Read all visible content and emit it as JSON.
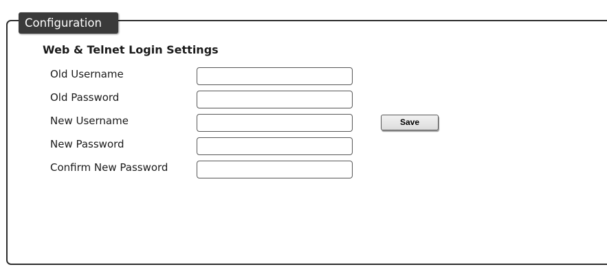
{
  "panel": {
    "tab_label": "Configuration"
  },
  "section": {
    "title": "Web & Telnet Login Settings"
  },
  "fields": [
    {
      "label": "Old Username",
      "value": "",
      "placeholder": ""
    },
    {
      "label": "Old Password",
      "value": "",
      "placeholder": ""
    },
    {
      "label": "New Username",
      "value": "",
      "placeholder": ""
    },
    {
      "label": "New Password",
      "value": "",
      "placeholder": ""
    },
    {
      "label": "Confirm New Password",
      "value": "",
      "placeholder": ""
    }
  ],
  "actions": {
    "save_label": "Save"
  },
  "colors": {
    "tab_background": "#3a3a3a",
    "tab_text": "#ffffff",
    "panel_border": "#2b2b2b",
    "input_border": "#555555"
  }
}
